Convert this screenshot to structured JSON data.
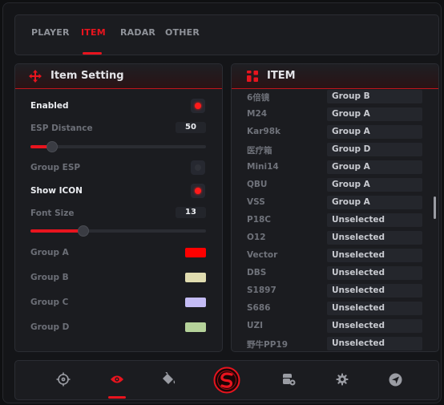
{
  "top_tabs": [
    {
      "label": "PLAYER",
      "active": false
    },
    {
      "label": "ITEM",
      "active": true
    },
    {
      "label": "RADAR",
      "active": false
    },
    {
      "label": "OTHER",
      "active": false
    }
  ],
  "settings_panel": {
    "title": "Item Setting",
    "icon": "move-arrows-icon",
    "enabled": {
      "label": "Enabled",
      "on": true
    },
    "esp_distance": {
      "label": "ESP Distance",
      "value": "50",
      "fraction": 0.12
    },
    "group_esp": {
      "label": "Group ESP",
      "on": false
    },
    "show_icon": {
      "label": "Show ICON",
      "on": true
    },
    "font_size": {
      "label": "Font Size",
      "value": "13",
      "fraction": 0.3
    },
    "groups": [
      {
        "label": "Group A",
        "color": "#ff0000"
      },
      {
        "label": "Group B",
        "color": "#e0dcb0"
      },
      {
        "label": "Group C",
        "color": "#c4bcf5"
      },
      {
        "label": "Group D",
        "color": "#b5d29a"
      }
    ]
  },
  "item_panel": {
    "title": "ITEM",
    "icon": "grid-icon",
    "items": [
      {
        "name": "6倍镜",
        "group": "Group B"
      },
      {
        "name": "M24",
        "group": "Group A"
      },
      {
        "name": "Kar98k",
        "group": "Group A"
      },
      {
        "name": "医疗箱",
        "group": "Group D"
      },
      {
        "name": "Mini14",
        "group": "Group A"
      },
      {
        "name": "QBU",
        "group": "Group A"
      },
      {
        "name": "VSS",
        "group": "Group A"
      },
      {
        "name": "P18C",
        "group": "Unselected"
      },
      {
        "name": "O12",
        "group": "Unselected"
      },
      {
        "name": "Vector",
        "group": "Unselected"
      },
      {
        "name": "DBS",
        "group": "Unselected"
      },
      {
        "name": "S1897",
        "group": "Unselected"
      },
      {
        "name": "S686",
        "group": "Unselected"
      },
      {
        "name": "UZI",
        "group": "Unselected"
      },
      {
        "name": "野牛PP19",
        "group": "Unselected"
      }
    ]
  },
  "bottom_nav": [
    {
      "icon": "crosshair-icon",
      "active": false
    },
    {
      "icon": "eye-icon",
      "active": true
    },
    {
      "icon": "paint-bucket-icon",
      "active": false
    },
    {
      "icon": "logo-icon",
      "active": false
    },
    {
      "icon": "car-settings-icon",
      "active": false
    },
    {
      "icon": "gear-icon",
      "active": false
    },
    {
      "icon": "send-icon",
      "active": false
    }
  ],
  "colors": {
    "accent": "#e8141e",
    "panel": "#1b1c20",
    "background": "#141518"
  }
}
